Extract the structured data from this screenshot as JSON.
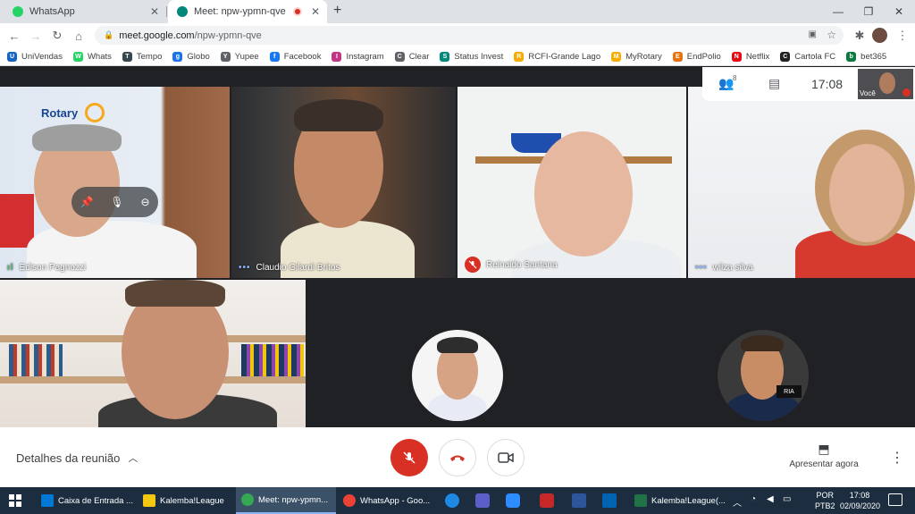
{
  "browser": {
    "tabs": [
      {
        "label": "WhatsApp",
        "color": "#25d366"
      },
      {
        "label": "Meet: npw-ypmn-qve",
        "color": "#00897b"
      }
    ],
    "new_tab": "+",
    "window_controls": [
      "—",
      "❐",
      "✕"
    ],
    "url_host": "meet.google.com",
    "url_path": "/npw-ypmn-qve",
    "bookmarks": [
      {
        "label": "UniVendas",
        "color": "#1565c0",
        "glyph": "U"
      },
      {
        "label": "Whats",
        "color": "#25d366",
        "glyph": "W"
      },
      {
        "label": "Tempo",
        "color": "#37474f",
        "glyph": "T"
      },
      {
        "label": "Globo",
        "color": "#1a73e8",
        "glyph": "g"
      },
      {
        "label": "Yupee",
        "color": "#5f6368",
        "glyph": "Y"
      },
      {
        "label": "Facebook",
        "color": "#1877f2",
        "glyph": "f"
      },
      {
        "label": "Instagram",
        "color": "#c13584",
        "glyph": "I"
      },
      {
        "label": "Clear",
        "color": "#5f6368",
        "glyph": "C"
      },
      {
        "label": "Status Invest",
        "color": "#00897b",
        "glyph": "S"
      },
      {
        "label": "RCFI-Grande Lago",
        "color": "#f9ab00",
        "glyph": "R"
      },
      {
        "label": "MyRotary",
        "color": "#f9ab00",
        "glyph": "M"
      },
      {
        "label": "EndPolio",
        "color": "#e8710a",
        "glyph": "E"
      },
      {
        "label": "Netflix",
        "color": "#e50914",
        "glyph": "N"
      },
      {
        "label": "Cartola FC",
        "color": "#202124",
        "glyph": "C"
      },
      {
        "label": "bet365",
        "color": "#0b7a3e",
        "glyph": "b"
      }
    ]
  },
  "meet": {
    "participants": [
      {
        "name": "Edison Pagnozzi",
        "indicator": "speaking"
      },
      {
        "name": "Claudio Gilardi Britos",
        "indicator": "dots"
      },
      {
        "name": "Reinaldo Santana",
        "indicator": "muted"
      },
      {
        "name": "wilza silva",
        "indicator": "dots"
      }
    ],
    "info": {
      "people_count": "8",
      "time": "17:08",
      "self_label": "Você"
    },
    "details_label": "Detalhes da reunião",
    "present_label": "Apresentar agora",
    "accent": "#1a73e8",
    "hangup_color": "#d93025"
  },
  "taskbar": {
    "items": [
      {
        "label": "Caixa de Entrada ...",
        "color": "#0078d4"
      },
      {
        "label": "Kalemba!League",
        "color": "#f2c811"
      },
      {
        "label": "Meet: npw-ypmn...",
        "color": "#34a853"
      },
      {
        "label": "WhatsApp - Goo...",
        "color": "#ea4335"
      },
      {
        "label": "Kalemba!League(...",
        "color": "#217346"
      }
    ],
    "lang": "POR",
    "layout": "PTB2",
    "time": "17:08",
    "date": "02/09/2020"
  }
}
